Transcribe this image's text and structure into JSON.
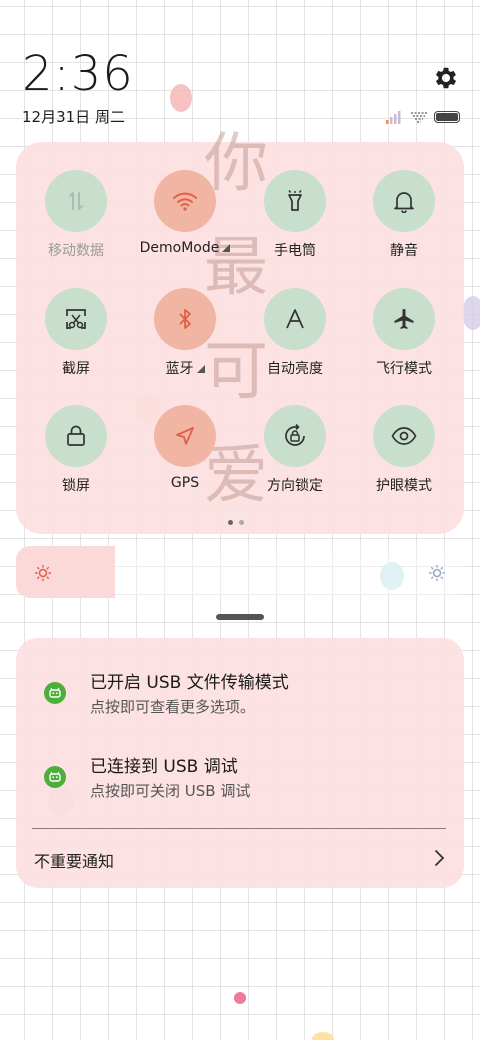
{
  "status": {
    "time": "2:36",
    "date": "12月31日 周二"
  },
  "wallpaper_text": [
    "你",
    "最",
    "可",
    "爱"
  ],
  "quick_settings": [
    {
      "label": "移动数据",
      "icon": "mobile-data-icon",
      "state": "disabled"
    },
    {
      "label": "DemoMode",
      "icon": "wifi-icon",
      "state": "on",
      "expand": true
    },
    {
      "label": "手电筒",
      "icon": "flashlight-icon",
      "state": "off"
    },
    {
      "label": "静音",
      "icon": "bell-icon",
      "state": "off"
    },
    {
      "label": "截屏",
      "icon": "screenshot-icon",
      "state": "off"
    },
    {
      "label": "蓝牙",
      "icon": "bluetooth-icon",
      "state": "on",
      "expand": true
    },
    {
      "label": "自动亮度",
      "icon": "auto-brightness-icon",
      "state": "off"
    },
    {
      "label": "飞行模式",
      "icon": "airplane-icon",
      "state": "off"
    },
    {
      "label": "锁屏",
      "icon": "lock-icon",
      "state": "off"
    },
    {
      "label": "GPS",
      "icon": "location-icon",
      "state": "on"
    },
    {
      "label": "方向锁定",
      "icon": "rotation-lock-icon",
      "state": "off"
    },
    {
      "label": "护眼模式",
      "icon": "eye-icon",
      "state": "off"
    }
  ],
  "page_indicator": {
    "pages": 2,
    "current": 1
  },
  "brightness": {
    "level": 0.22
  },
  "notifications": [
    {
      "title": "已开启 USB 文件传输模式",
      "body": "点按即可查看更多选项。",
      "icon": "android-icon"
    },
    {
      "title": "已连接到 USB 调试",
      "body": "点按即可关闭 USB 调试",
      "icon": "android-icon"
    }
  ],
  "unimportant_label": "不重要通知",
  "colors": {
    "on_tile": "#f0b6a3",
    "off_tile": "#c8dfcd",
    "on_icon": "#e0604a",
    "panel": "#fcdede",
    "notif_icon": "#4caf3a"
  }
}
